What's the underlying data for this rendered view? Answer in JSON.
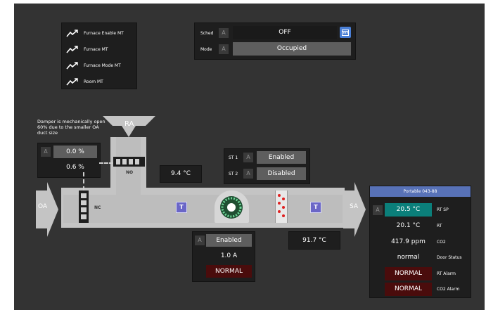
{
  "trends": [
    {
      "label": "Furnace Enable MT",
      "icon": "trend-icon"
    },
    {
      "label": "Furnace MT",
      "icon": "trend-icon"
    },
    {
      "label": "Furnace Mode MT",
      "icon": "trend-icon"
    },
    {
      "label": "Room MT",
      "icon": "trend-icon"
    }
  ],
  "schedule": {
    "sched_label": "Sched",
    "sched_a": "A",
    "sched_value": "OFF",
    "mode_label": "Mode",
    "mode_a": "A",
    "mode_value": "Occupied",
    "calendar_icon": "calendar-icon"
  },
  "damper": {
    "note": "Damper is mechanically open 60% due to the smaller OA duct size",
    "a": "A",
    "command": "0.0 %",
    "feedback": "0.6 %"
  },
  "duct": {
    "ra_label": "RA",
    "oa_label": "OA",
    "sa_label": "SA",
    "no_label": "NO",
    "nc_label": "NC",
    "ra_temp": "9.4 °C",
    "sa_temp": "91.7 °C",
    "t_label": "T"
  },
  "stages": [
    {
      "label": "ST 1",
      "a": "A",
      "value": "Enabled"
    },
    {
      "label": "ST 2",
      "a": "A",
      "value": "Disabled"
    }
  ],
  "fan": {
    "a": "A",
    "status": "Enabled",
    "current": "1.0 A",
    "alarm": "NORMAL"
  },
  "portable": {
    "title": "Portable 043-88",
    "a": "A",
    "rows": [
      {
        "value": "20.5 °C",
        "label": "RT SP"
      },
      {
        "value": "20.1 °C",
        "label": "RT"
      },
      {
        "value": "417.9 ppm",
        "label": "CO2"
      },
      {
        "value": "normal",
        "label": "Door Status"
      },
      {
        "value": "NORMAL",
        "label": "RT Alarm"
      },
      {
        "value": "NORMAL",
        "label": "CO2 Alarm"
      }
    ]
  },
  "colors": {
    "background": "#333333",
    "panel": "#1e1e1e",
    "duct": "#c4c4c4",
    "teal": "#0b7f7a",
    "alarm_bg": "#4a0c0c",
    "header_blue": "#5872b7",
    "tstat": "#6a66c7"
  }
}
